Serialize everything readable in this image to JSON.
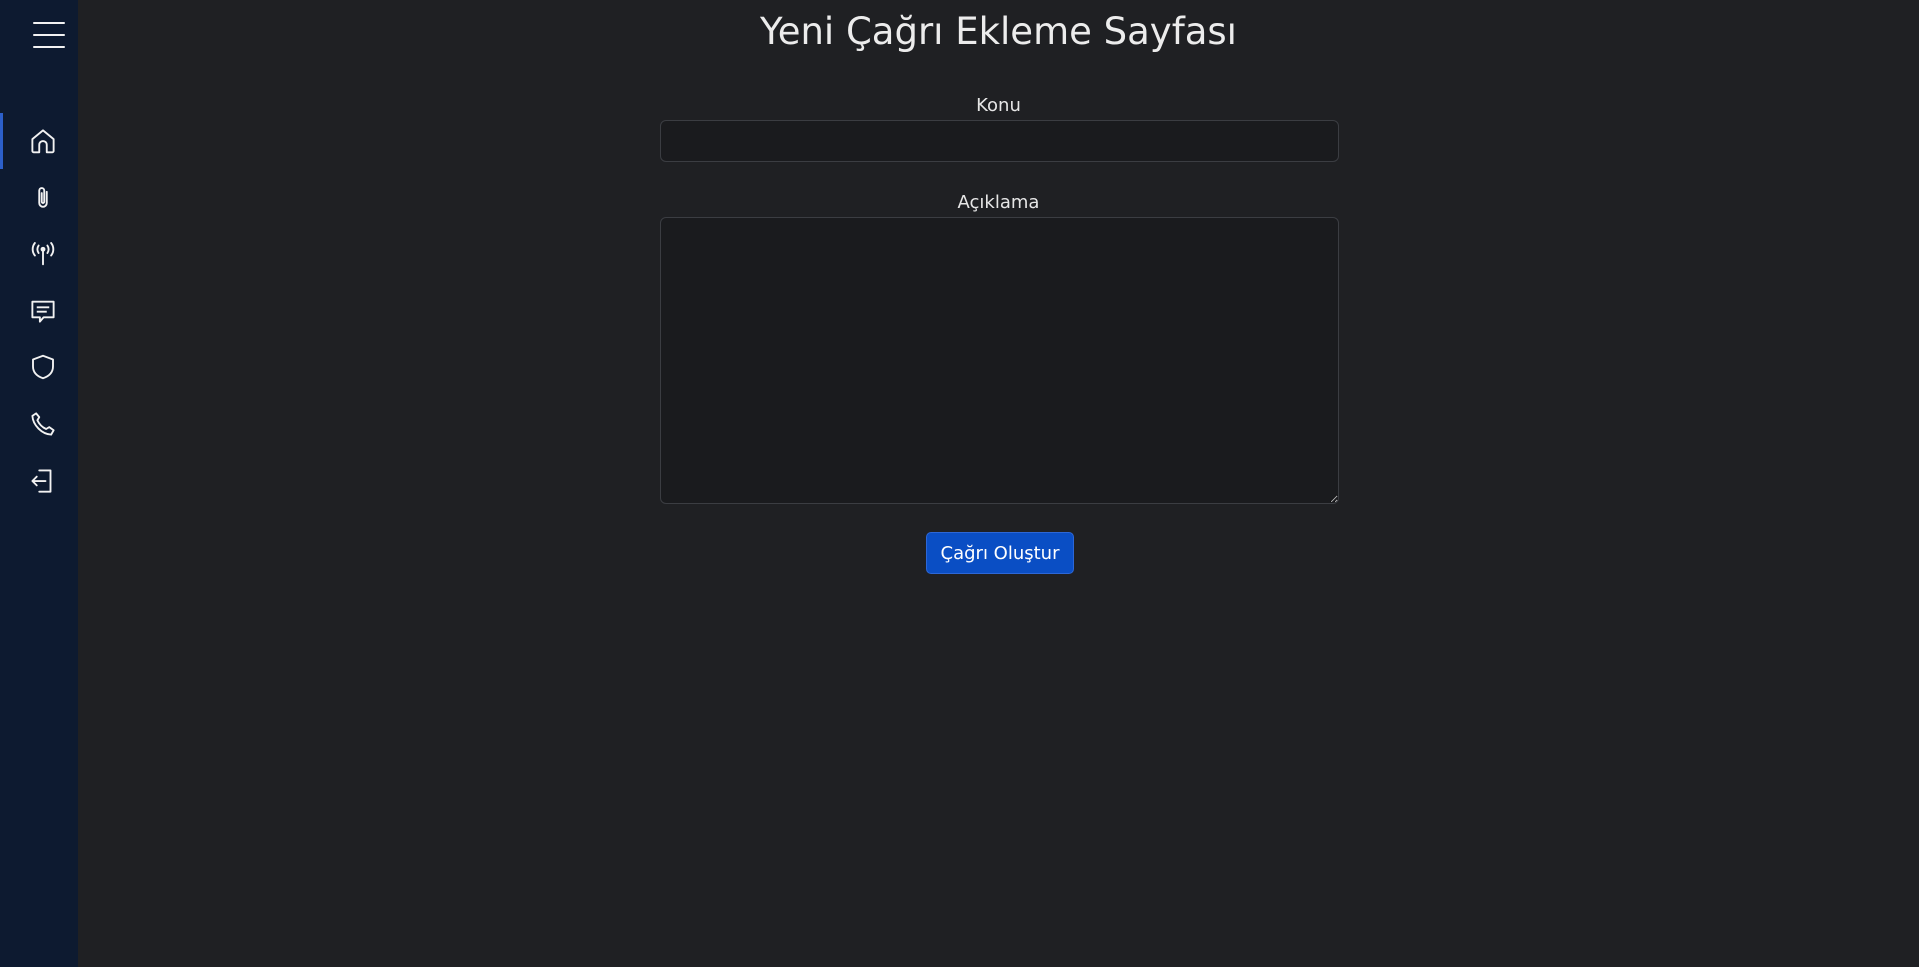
{
  "page": {
    "title": "Yeni Çağrı Ekleme Sayfası"
  },
  "sidebar": {
    "items": [
      {
        "icon": "home-icon",
        "active": true
      },
      {
        "icon": "paperclip-icon",
        "active": false
      },
      {
        "icon": "antenna-icon",
        "active": false
      },
      {
        "icon": "chat-icon",
        "active": false
      },
      {
        "icon": "shield-icon",
        "active": false
      },
      {
        "icon": "phone-icon",
        "active": false
      },
      {
        "icon": "logout-icon",
        "active": false
      }
    ]
  },
  "form": {
    "subject_label": "Konu",
    "subject_value": "",
    "description_label": "Açıklama",
    "description_value": "",
    "submit_label": "Çağrı Oluştur"
  },
  "colors": {
    "background": "#1f2023",
    "sidebar": "#0d1a30",
    "accent": "#0a4ec4"
  }
}
